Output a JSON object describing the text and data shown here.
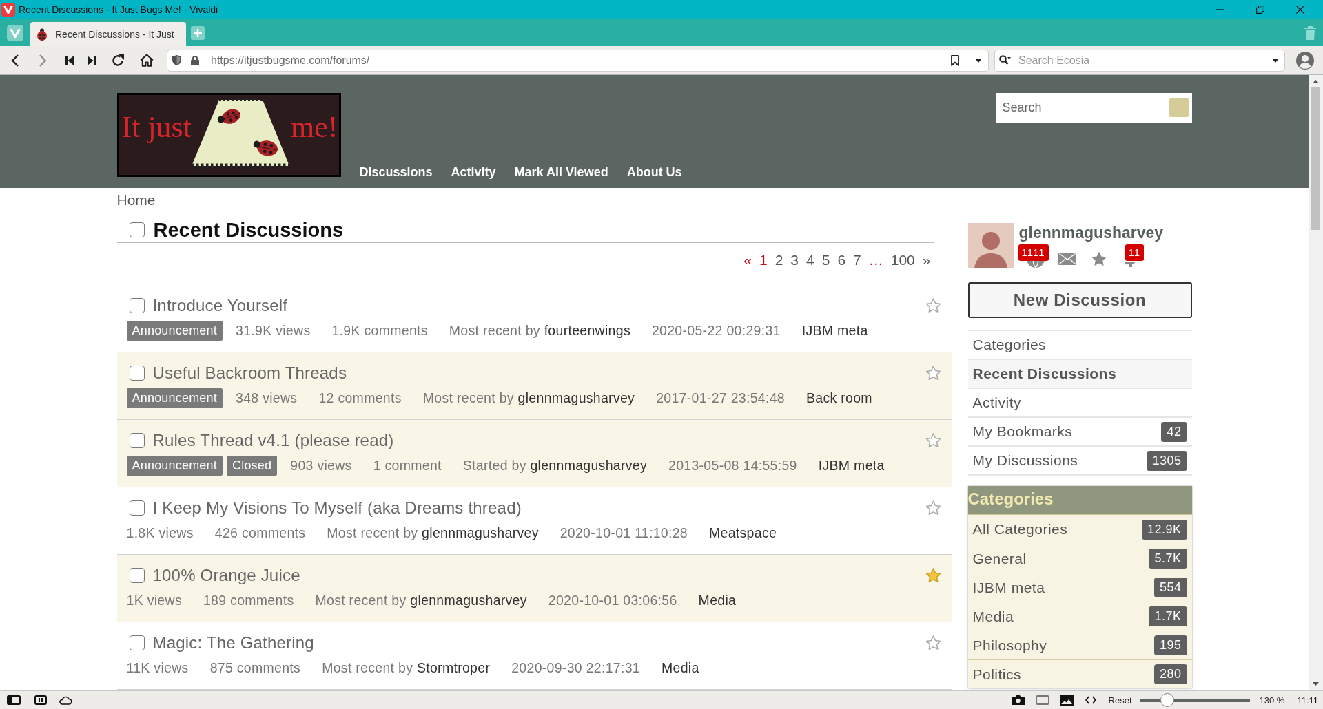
{
  "window": {
    "title": "Recent Discussions - It Just Bugs Me! - Vivaldi"
  },
  "tabs": [
    {
      "title": "Recent Discussions - It Just",
      "selected": true
    }
  ],
  "toolbar": {
    "buttons": [
      {
        "kind": "back",
        "disabled": false
      },
      {
        "kind": "forward",
        "disabled": true
      },
      {
        "kind": "rewind",
        "disabled": false
      },
      {
        "kind": "fast_forward",
        "disabled": false
      },
      {
        "kind": "reload",
        "disabled": false
      },
      {
        "kind": "home",
        "disabled": false
      }
    ],
    "url": "https://itjustbugsme.com/forums/",
    "search": {
      "placeholder": "Search Ecosia"
    }
  },
  "site_header": {
    "logo": {
      "left": "It just",
      "right": "me!"
    },
    "nav": [
      "Discussions",
      "Activity",
      "Mark All Viewed",
      "About Us"
    ],
    "search": {
      "placeholder": "Search"
    }
  },
  "breadcrumb": "Home",
  "heading": {
    "title": "Recent Discussions",
    "checked": false
  },
  "pagination": [
    {
      "label": "«",
      "kind": "prev",
      "disabled": true
    },
    {
      "label": "1",
      "kind": "page",
      "selected": true
    },
    {
      "label": "2",
      "kind": "page",
      "selected": false
    },
    {
      "label": "3",
      "kind": "page",
      "selected": false
    },
    {
      "label": "4",
      "kind": "page",
      "selected": false
    },
    {
      "label": "5",
      "kind": "page",
      "selected": false
    },
    {
      "label": "6",
      "kind": "page",
      "selected": false
    },
    {
      "label": "7",
      "kind": "page",
      "selected": false
    },
    {
      "label": "…",
      "kind": "ellipsis"
    },
    {
      "label": "100",
      "kind": "page",
      "selected": false
    },
    {
      "label": "»",
      "kind": "next",
      "disabled": false
    }
  ],
  "discussions": [
    {
      "title": "Introduce Yourself",
      "checked": false,
      "bookmarked": false,
      "highlighted": false,
      "tags": [
        "Announcement"
      ],
      "views": "31.9K views",
      "comments": "1.9K comments",
      "last_by_label": "Most recent by",
      "last_by_user": "fourteenwings",
      "date": "2020-05-22 00:29:31",
      "category": "IJBM meta"
    },
    {
      "title": "Useful Backroom Threads",
      "checked": false,
      "bookmarked": false,
      "highlighted": true,
      "tags": [
        "Announcement"
      ],
      "views": "348 views",
      "comments": "12 comments",
      "last_by_label": "Most recent by",
      "last_by_user": "glennmagusharvey",
      "date": "2017-01-27 23:54:48",
      "category": "Back room"
    },
    {
      "title": "Rules Thread v4.1 (please read)",
      "checked": false,
      "bookmarked": false,
      "highlighted": true,
      "tags": [
        "Announcement",
        "Closed"
      ],
      "views": "903 views",
      "comments": "1 comment",
      "last_by_label": "Started by",
      "last_by_user": "glennmagusharvey",
      "date": "2013-05-08 14:55:59",
      "category": "IJBM meta"
    },
    {
      "title": "I Keep My Visions To Myself (aka Dreams thread)",
      "checked": false,
      "bookmarked": false,
      "highlighted": false,
      "views": "1.8K views",
      "comments": "426 comments",
      "last_by_label": "Most recent by",
      "last_by_user": "glennmagusharvey",
      "date": "2020-10-01 11:10:28",
      "category": "Meatspace"
    },
    {
      "title": "100% Orange Juice",
      "checked": false,
      "bookmarked": true,
      "highlighted": true,
      "views": "1K views",
      "comments": "189 comments",
      "last_by_label": "Most recent by",
      "last_by_user": "glennmagusharvey",
      "date": "2020-10-01 03:06:56",
      "category": "Media"
    },
    {
      "title": "Magic: The Gathering",
      "checked": false,
      "bookmarked": false,
      "highlighted": false,
      "views": "11K views",
      "comments": "875 comments",
      "last_by_label": "Most recent by",
      "last_by_user": "Stormtroper",
      "date": "2020-09-30 22:17:31",
      "category": "Media"
    }
  ],
  "sidebar": {
    "user": {
      "name": "glennmagusharvey",
      "notification_count": "1111",
      "alert_count": "11"
    },
    "new_discussion": "New Discussion",
    "nav": [
      {
        "label": "Categories",
        "selected": false
      },
      {
        "label": "Recent Discussions",
        "selected": true
      },
      {
        "label": "Activity",
        "selected": false
      },
      {
        "label": "My Bookmarks",
        "count": "42",
        "selected": false
      },
      {
        "label": "My Discussions",
        "count": "1305",
        "selected": false
      }
    ],
    "categories": {
      "title": "Categories",
      "items": [
        {
          "label": "All Categories",
          "count": "12.9K"
        },
        {
          "label": "General",
          "count": "5.7K"
        },
        {
          "label": "IJBM meta",
          "count": "554"
        },
        {
          "label": "Media",
          "count": "1.7K"
        },
        {
          "label": "Philosophy",
          "count": "195"
        },
        {
          "label": "Politics",
          "count": "280"
        }
      ]
    }
  },
  "status_bar": {
    "reset": "Reset",
    "zoom": {
      "level": 0.22
    },
    "reading": "130 %",
    "clock": "11:11"
  }
}
